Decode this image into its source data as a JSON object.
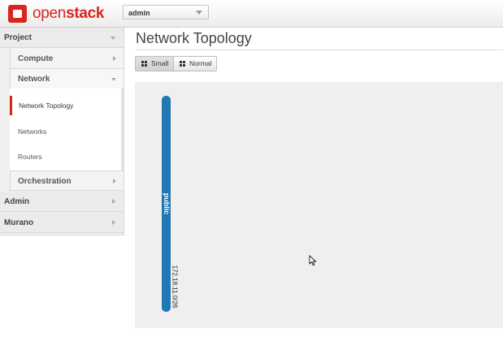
{
  "brand": {
    "open": "open",
    "stack": "stack",
    "accent": "#d9261c"
  },
  "project_selector": {
    "value": "admin"
  },
  "sidebar": {
    "dashboards": [
      {
        "label": "Project",
        "expanded": true
      },
      {
        "label": "Admin",
        "expanded": false
      },
      {
        "label": "Murano",
        "expanded": false
      }
    ],
    "panels": [
      {
        "label": "Compute",
        "expanded": false
      },
      {
        "label": "Network",
        "expanded": true
      },
      {
        "label": "Orchestration",
        "expanded": false
      }
    ],
    "network_items": [
      {
        "label": "Network Topology",
        "active": true
      },
      {
        "label": "Networks",
        "active": false
      },
      {
        "label": "Routers",
        "active": false
      }
    ]
  },
  "main": {
    "title": "Network Topology",
    "view_toggle": [
      {
        "label": "Small",
        "icon": "grid-small-icon",
        "active": true
      },
      {
        "label": "Normal",
        "icon": "grid-large-icon",
        "active": false
      }
    ]
  },
  "topology": {
    "networks": [
      {
        "name": "public",
        "cidr": "172.18.11.0/26",
        "color": "#1f77b4"
      }
    ]
  }
}
